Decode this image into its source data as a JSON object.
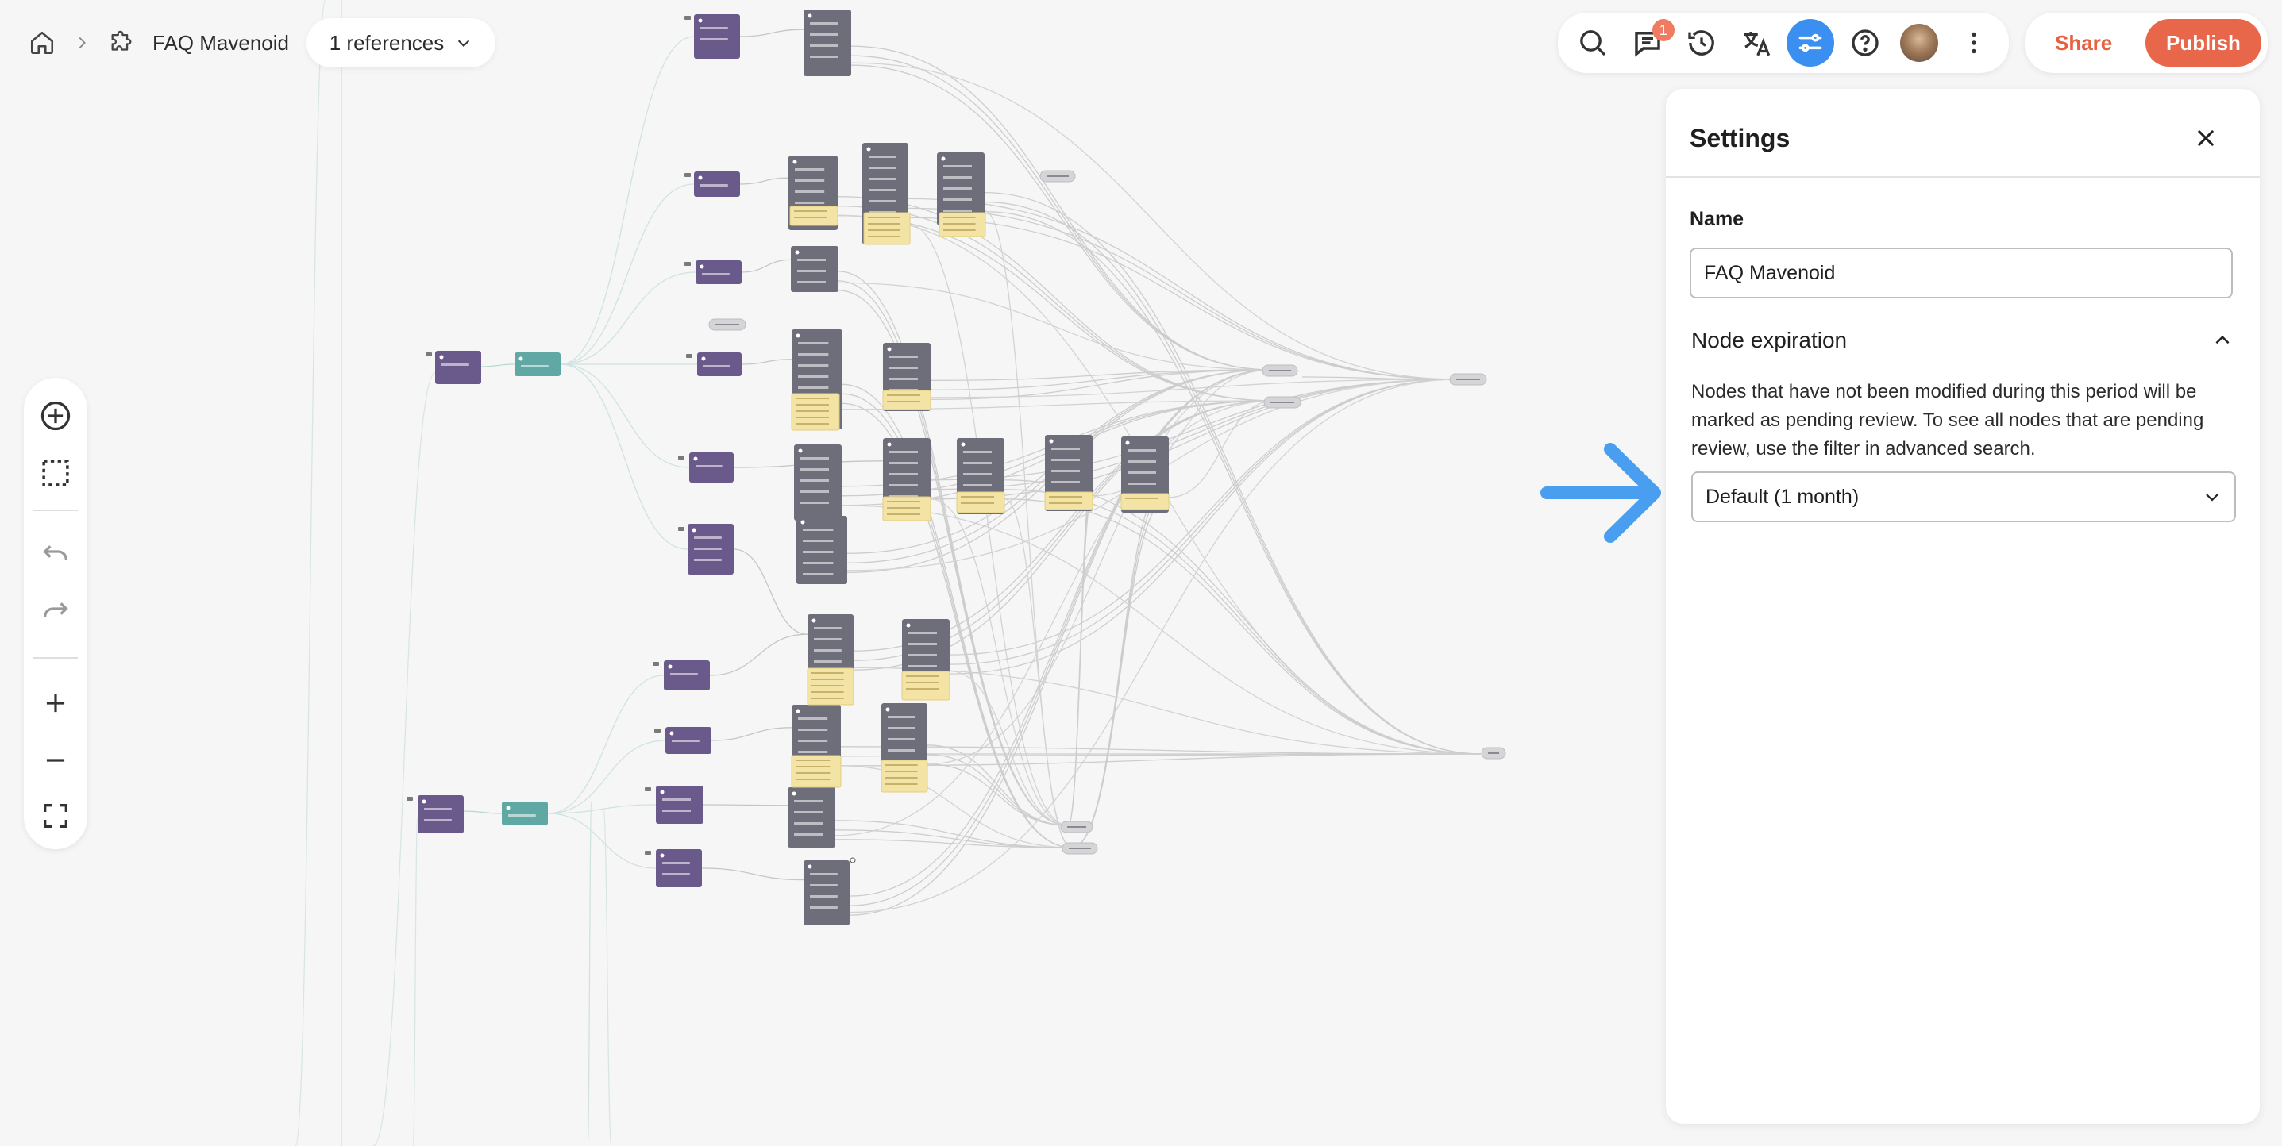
{
  "breadcrumb": {
    "home_icon": "home-icon",
    "separator_icon": "chevron-right-icon",
    "flow_icon": "puzzle-icon",
    "flow_name": "FAQ Mavenoid"
  },
  "references": {
    "label": "1 references",
    "icon": "chevron-down-icon"
  },
  "toolbar": {
    "items": [
      {
        "name": "search",
        "icon": "search-icon"
      },
      {
        "name": "comments",
        "icon": "comment-icon",
        "badge": "1"
      },
      {
        "name": "history",
        "icon": "history-icon"
      },
      {
        "name": "translate",
        "icon": "translate-icon"
      },
      {
        "name": "settings",
        "icon": "sliders-icon",
        "active": true
      },
      {
        "name": "help",
        "icon": "help-icon"
      },
      {
        "name": "avatar",
        "icon": "user-avatar"
      },
      {
        "name": "more",
        "icon": "more-vertical-icon"
      }
    ],
    "accent_color": "#3b8ff0"
  },
  "actions": {
    "share_label": "Share",
    "publish_label": "Publish",
    "publish_color": "#e8674a"
  },
  "canvas_tools": [
    {
      "name": "add-node",
      "icon": "plus-circle-icon"
    },
    {
      "name": "select-area",
      "icon": "dashed-square-icon"
    },
    {
      "name": "undo",
      "icon": "undo-icon"
    },
    {
      "name": "redo",
      "icon": "redo-icon"
    },
    {
      "name": "zoom-in",
      "icon": "plus-icon"
    },
    {
      "name": "zoom-out",
      "icon": "minus-icon"
    },
    {
      "name": "fit-view",
      "icon": "fit-screen-icon"
    }
  ],
  "settings": {
    "title": "Settings",
    "close_icon": "close-icon",
    "name_label": "Name",
    "name_value": "FAQ Mavenoid",
    "node_expiration": {
      "title": "Node expiration",
      "toggle_icon": "chevron-up-icon",
      "description": "Nodes that have not been modified during this period will be marked as pending review. To see all nodes that are pending review, use the filter in advanced search.",
      "selected": "Default (1 month)",
      "select_icon": "chevron-down-icon"
    }
  },
  "annotation": {
    "icon": "arrow-right-icon",
    "color": "#4a9ef0"
  },
  "colors": {
    "question_node": "#6a5a8c",
    "root_node": "#5fa8a3",
    "answer_node": "#6e6e7a",
    "note": "#f3e3a4"
  }
}
